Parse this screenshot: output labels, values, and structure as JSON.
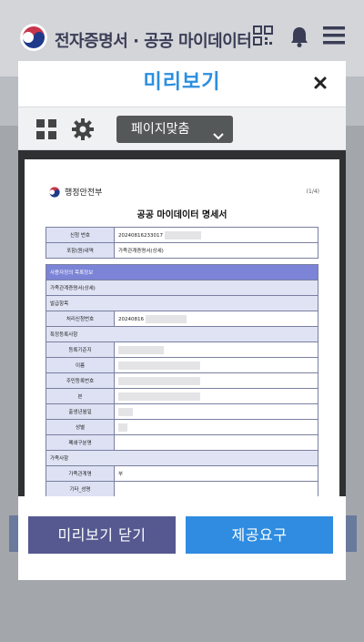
{
  "app_header": {
    "title": "전자증명서 · 공공 마이데이터",
    "icons": [
      "qr-code-icon",
      "bell-icon",
      "menu-icon"
    ]
  },
  "modal": {
    "title": "미리보기",
    "toolbar": {
      "zoom_value": "페이지맞춤"
    },
    "document": {
      "org_name": "행정안전부",
      "page_indicator": "(1/4)",
      "title": "공공 마이데이터 명세서",
      "info_rows": [
        {
          "label": "신청 번호",
          "value": "20240816233017"
        },
        {
          "label": "포함(원)내역",
          "value": "가족관계증명서(상세)"
        }
      ],
      "section_header": "사용자정의 목록정보",
      "subsection": "가족관계증명서(상세)",
      "issue_header": "발급항목",
      "issue_rows": [
        {
          "label": "처리신청번호",
          "value": "20240816"
        }
      ],
      "registration_header": "특정등록사항",
      "registration_rows": [
        {
          "label": "등록기준지",
          "value": ""
        },
        {
          "label": "이름",
          "value": ""
        },
        {
          "label": "주민등록번호",
          "value": ""
        },
        {
          "label": "본",
          "value": ""
        },
        {
          "label": "출생년월일",
          "value": ""
        },
        {
          "label": "성별",
          "value": ""
        },
        {
          "label": "폐쇄구분명",
          "value": ""
        }
      ],
      "family_header": "가족사항",
      "family_rows": [
        {
          "label": "가족관계명",
          "value": "부"
        },
        {
          "label": "기타_성명",
          "value": ""
        }
      ]
    },
    "buttons": {
      "close_preview": "미리보기 닫기",
      "request": "제공요구"
    }
  },
  "colors": {
    "accent": "#2f8ce0",
    "close_button": "#555990",
    "section_header": "#7b84d6"
  }
}
